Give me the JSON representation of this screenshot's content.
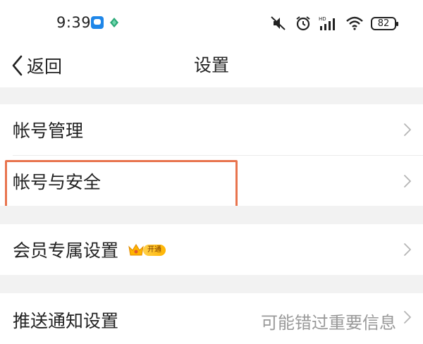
{
  "status_bar": {
    "time": "9:39",
    "battery": "82",
    "icons": [
      "app-notification-icon",
      "leaf-icon",
      "mute-icon",
      "alarm-icon",
      "hd-signal-icon",
      "wifi-icon",
      "battery-icon"
    ]
  },
  "nav": {
    "back_label": "返回",
    "title": "设置"
  },
  "settings": {
    "account_management": "帐号管理",
    "account_security": "帐号与安全",
    "vip_settings": "会员专属设置",
    "vip_badge": "开通",
    "push_notifications": "推送通知设置",
    "push_hint": "可能错过重要信息"
  },
  "colors": {
    "highlight_border": "#e8744e",
    "section_gap": "#f2f2f2",
    "accent_blue": "#1e86e8",
    "vip_gold": "#ffb400"
  }
}
